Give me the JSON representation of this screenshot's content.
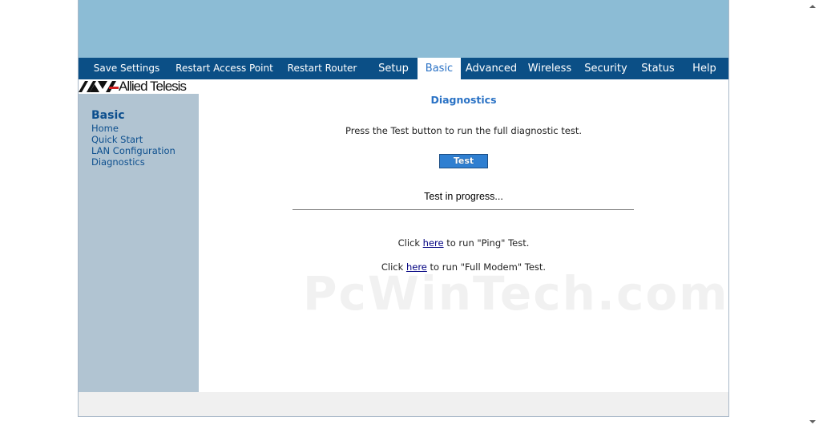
{
  "nav": {
    "items": [
      {
        "label": "Save Settings"
      },
      {
        "label": "Restart Access Point"
      },
      {
        "label": "Restart Router"
      },
      {
        "label": "Setup"
      },
      {
        "label": "Basic",
        "active": true
      },
      {
        "label": "Advanced"
      },
      {
        "label": "Wireless"
      },
      {
        "label": "Security"
      },
      {
        "label": "Status"
      },
      {
        "label": "Help"
      }
    ]
  },
  "logo": {
    "text": "Allied Telesis"
  },
  "sidebar": {
    "title": "Basic",
    "links": [
      "Home",
      "Quick Start",
      "LAN Configuration",
      "Diagnostics"
    ]
  },
  "main": {
    "title": "Diagnostics",
    "instruction": "Press the Test button to run the full diagnostic test.",
    "test_button": "Test",
    "progress": "Test in progress...",
    "ping": {
      "prefix": "Click ",
      "link": "here",
      "suffix": " to run \"Ping\" Test."
    },
    "modem": {
      "prefix": "Click ",
      "link": "here",
      "suffix": " to run \"Full Modem\" Test."
    }
  },
  "watermark": "PcWinTech.com",
  "colors": {
    "banner": "#8cbcd5",
    "nav_bar": "#0b4f86",
    "active_tab_text": "#2a72c5",
    "sidebar": "#b1c4d2",
    "accent": "#2f7fd1"
  }
}
